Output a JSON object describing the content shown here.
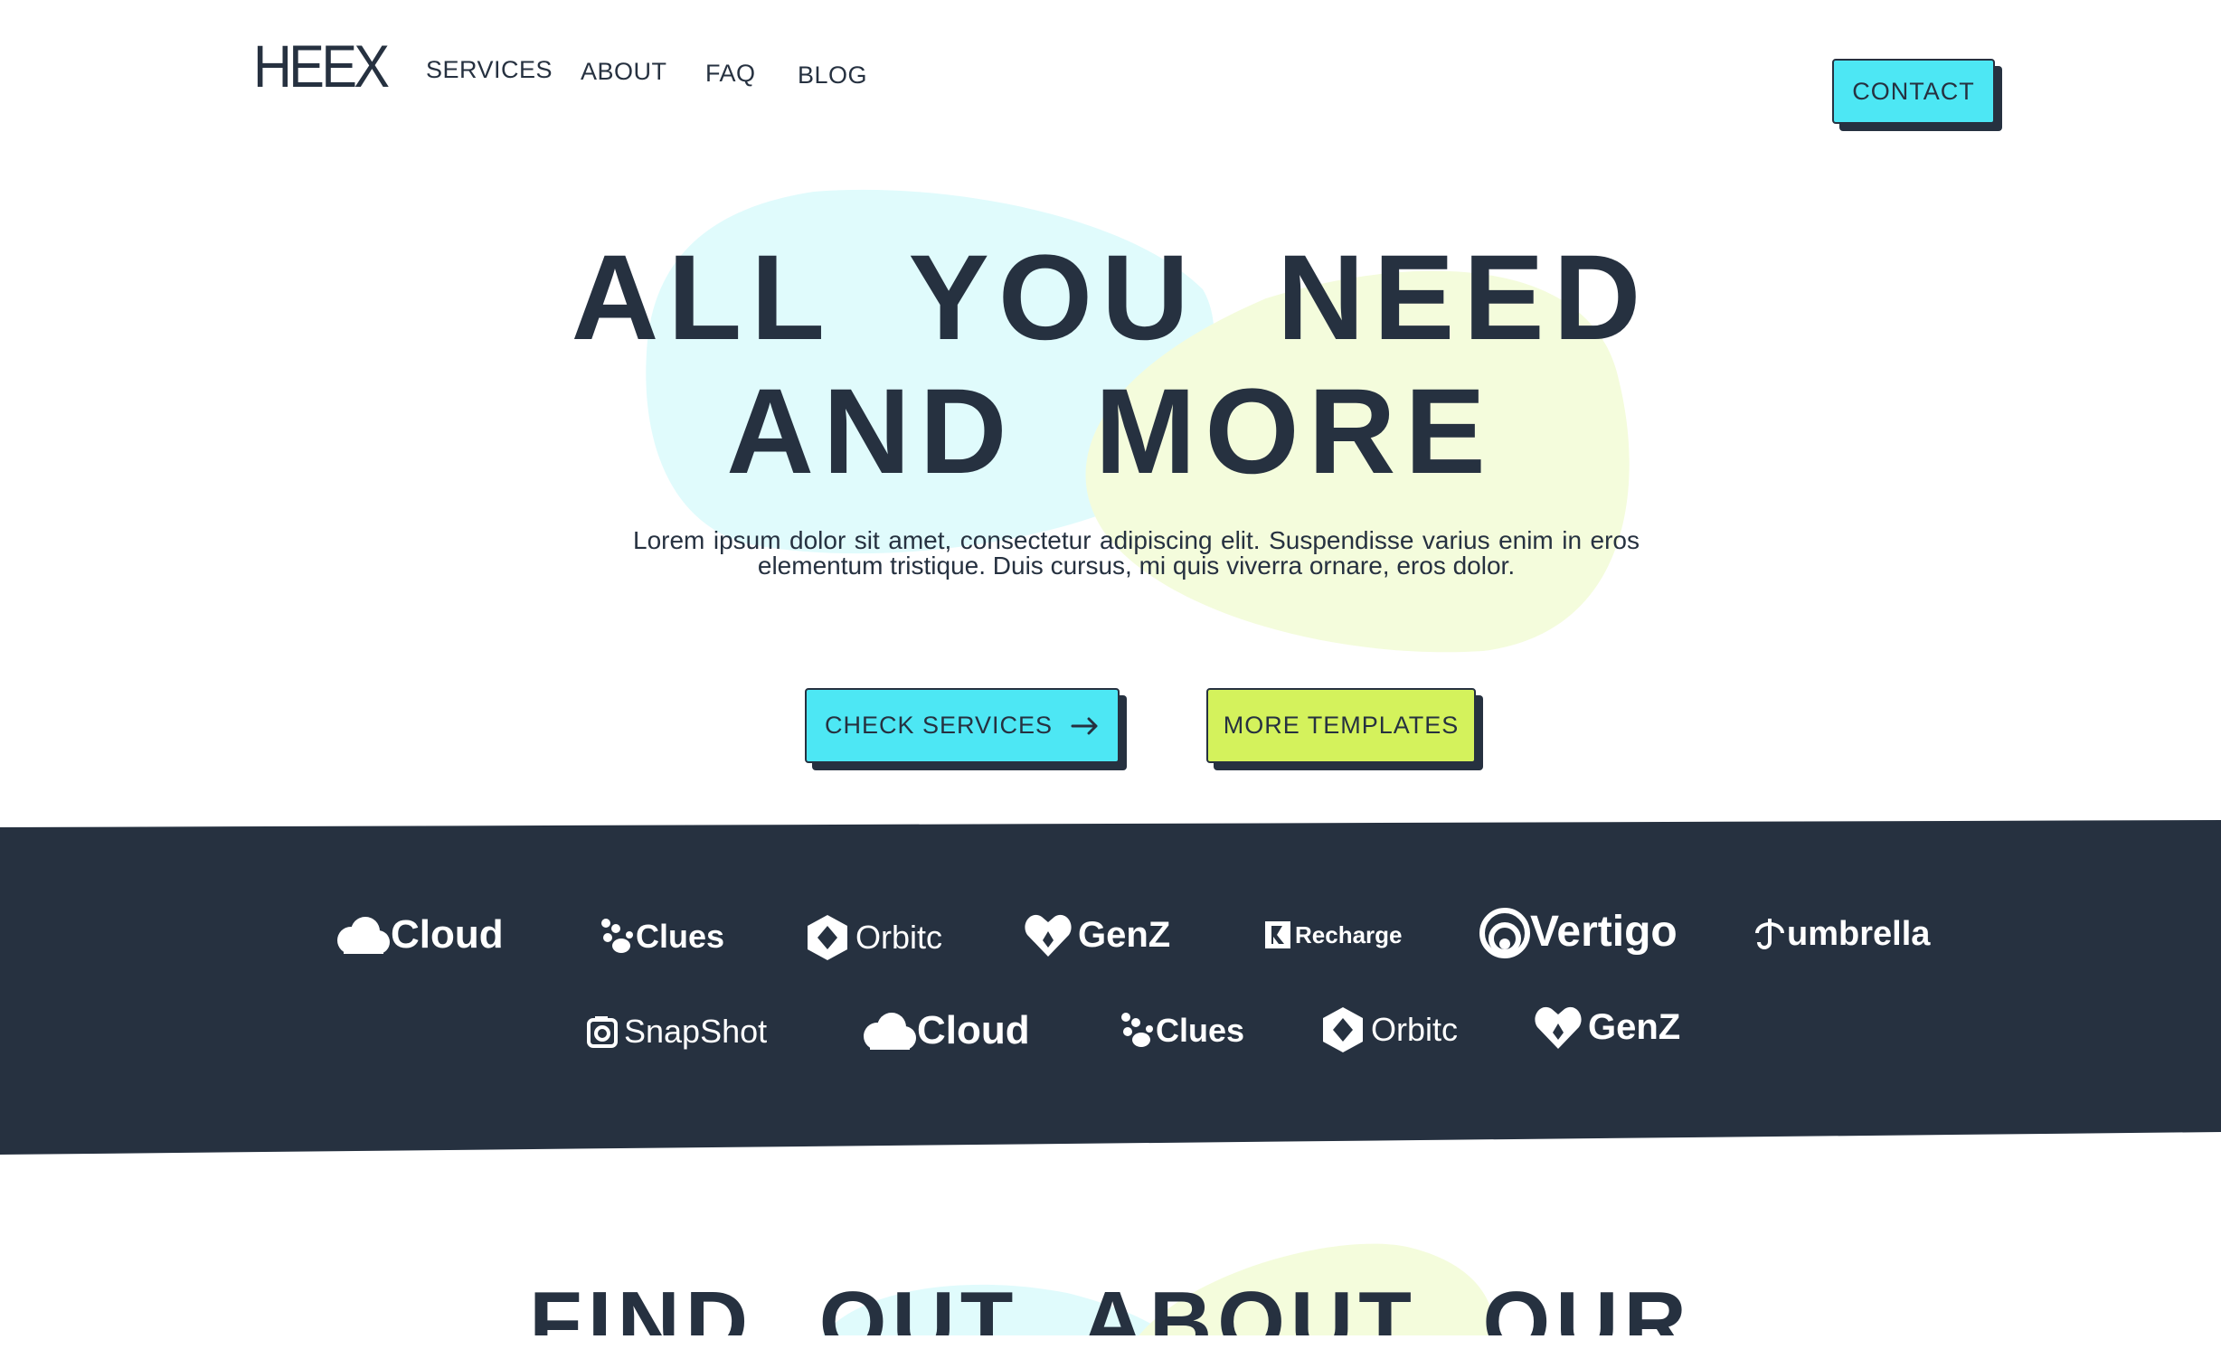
{
  "header": {
    "logo": "HEEX",
    "nav": [
      {
        "label": "SERVICES"
      },
      {
        "label": "ABOUT"
      },
      {
        "label": "FAQ"
      },
      {
        "label": "BLOG"
      }
    ],
    "contact_label": "CONTACT"
  },
  "hero": {
    "line1": "ALL YOU NEED",
    "line2": "AND MORE",
    "subtitle": "Lorem ipsum dolor sit amet, consectetur adipiscing elit. Suspendisse varius enim in eros elementum tristique. Duis cursus, mi quis viverra ornare, eros dolor.",
    "primary_button": "CHECK SERVICES",
    "secondary_button": "MORE TEMPLATES"
  },
  "logos": {
    "row1": [
      {
        "name": "Cloud",
        "icon": "cloud-icon"
      },
      {
        "name": "Clues",
        "icon": "paw-icon"
      },
      {
        "name": "Orbitc",
        "icon": "hexagon-icon"
      },
      {
        "name": "GenZ",
        "icon": "heart-icon"
      },
      {
        "name": "Recharge",
        "icon": "recharge-icon"
      },
      {
        "name": "Vertigo",
        "icon": "spiral-icon"
      },
      {
        "name": "umbrella",
        "icon": "umbrella-icon"
      }
    ],
    "row2": [
      {
        "name": "SnapShot",
        "icon": "camera-icon"
      },
      {
        "name": "Cloud",
        "icon": "cloud-icon"
      },
      {
        "name": "Clues",
        "icon": "paw-icon"
      },
      {
        "name": "Orbitc",
        "icon": "hexagon-icon"
      },
      {
        "name": "GenZ",
        "icon": "heart-icon"
      }
    ]
  },
  "section": {
    "heading": "FIND OUT ABOUT OUR"
  },
  "colors": {
    "dark": "#263140",
    "cyan": "#4de7f4",
    "lime": "#d4f25c",
    "blob_cyan": "#e0fbfc",
    "blob_lime": "#f4fcdc",
    "white": "#ffffff"
  }
}
